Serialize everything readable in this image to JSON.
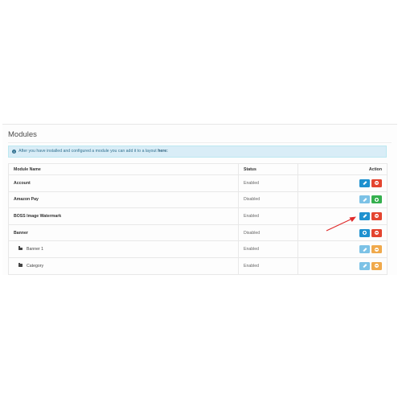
{
  "panel": {
    "title": "Modules"
  },
  "alert": {
    "text": "After you have installed and configured a module you can add it to a layout",
    "link": "here:"
  },
  "table": {
    "headers": {
      "name": "Module Name",
      "status": "Status",
      "action": "Action"
    },
    "rows": [
      {
        "name": "Account",
        "status": "Enabled",
        "installed": true
      },
      {
        "name": "Amazon Pay",
        "status": "Disabled",
        "installed": false
      },
      {
        "name": "BOSS Image Watermark",
        "status": "Enabled",
        "installed": true
      },
      {
        "name": "Banner",
        "status": "Disabled",
        "installed": false
      },
      {
        "name": "Banner 1",
        "status": "Enabled",
        "sub": true
      },
      {
        "name": "Category",
        "status": "Enabled",
        "sub": true
      }
    ]
  },
  "icons": {
    "info": "info-circle-icon",
    "folder": "folder-icon",
    "edit": "pencil-icon",
    "uninstall": "minus-circle-icon",
    "install": "plus-circle-icon",
    "annotation": "red-arrow"
  },
  "colors": {
    "edit": "#1e91cf",
    "uninstall": "#e4442f",
    "install": "#35b04e",
    "sub_edit": "#7cc2e6",
    "sub_action": "#f0a94b",
    "alert_bg": "#d9edf7",
    "annotation": "#e02b2b"
  }
}
